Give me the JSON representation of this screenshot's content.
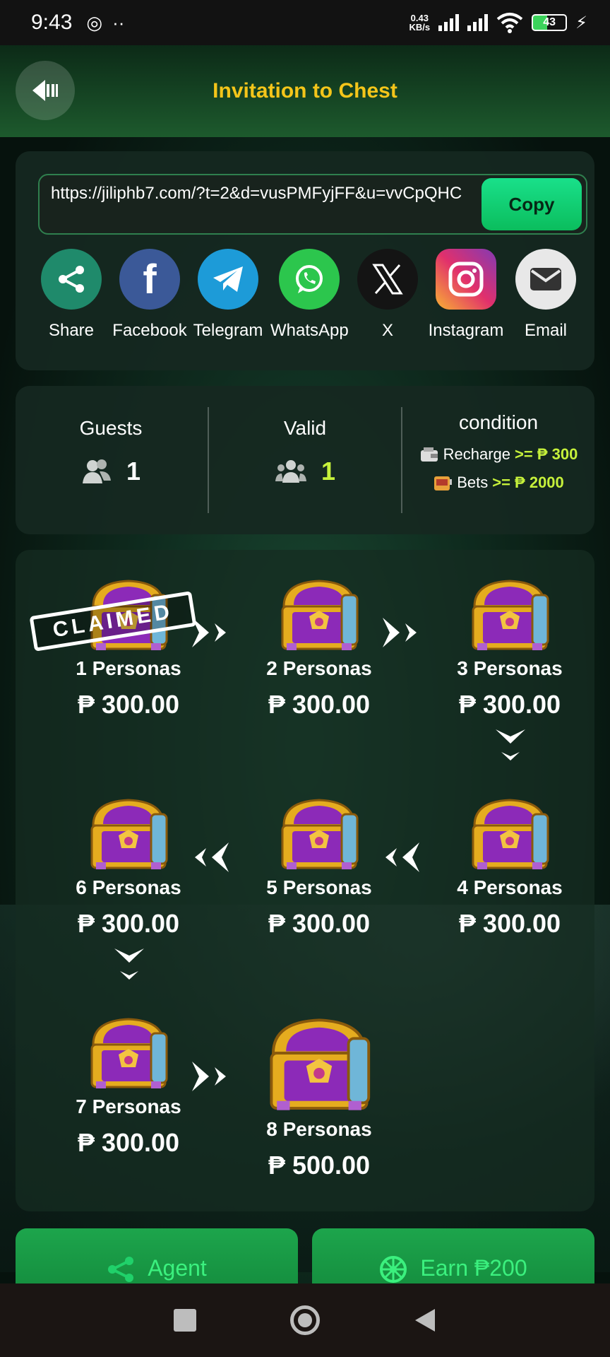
{
  "status_bar": {
    "time": "9:43",
    "net_speed_value": "0.43",
    "net_speed_unit": "KB/s",
    "battery": "43",
    "wifi_label": "6"
  },
  "header": {
    "title": "Invitation to Chest"
  },
  "invite": {
    "link": "https://jiliphb7.com/?t=2&d=vusPMFyjFF&u=vvCpQHC",
    "copy_label": "Copy"
  },
  "share": [
    {
      "label": "Share",
      "icon": "share-icon",
      "color": "#1f8a6b"
    },
    {
      "label": "Facebook",
      "icon": "facebook-icon",
      "color": "#3b5998"
    },
    {
      "label": "Telegram",
      "icon": "telegram-icon",
      "color": "#1d9bd8"
    },
    {
      "label": "WhatsApp",
      "icon": "whatsapp-icon",
      "color": "#2cc64d"
    },
    {
      "label": "X",
      "icon": "x-icon",
      "color": "#111111"
    },
    {
      "label": "Instagram",
      "icon": "instagram-icon",
      "color": "#d6307a"
    },
    {
      "label": "Email",
      "icon": "email-icon",
      "color": "#e8e8e8"
    }
  ],
  "stats": {
    "guests_label": "Guests",
    "guests_value": "1",
    "valid_label": "Valid",
    "valid_value": "1",
    "condition_label": "condition",
    "recharge_label": "Recharge",
    "recharge_req": ">= ₱ 300",
    "bets_label": "Bets",
    "bets_req": ">= ₱ 2000"
  },
  "chests": [
    {
      "label": "1 Personas",
      "amount": "₱ 300.00",
      "claimed": true
    },
    {
      "label": "2 Personas",
      "amount": "₱ 300.00",
      "claimed": false
    },
    {
      "label": "3 Personas",
      "amount": "₱ 300.00",
      "claimed": false
    },
    {
      "label": "4 Personas",
      "amount": "₱ 300.00",
      "claimed": false
    },
    {
      "label": "5 Personas",
      "amount": "₱ 300.00",
      "claimed": false
    },
    {
      "label": "6 Personas",
      "amount": "₱ 300.00",
      "claimed": false
    },
    {
      "label": "7 Personas",
      "amount": "₱ 300.00",
      "claimed": false
    },
    {
      "label": "8 Personas",
      "amount": "₱ 500.00",
      "claimed": false
    }
  ],
  "claimed_stamp": "CLAIMED",
  "bottom": {
    "agent_label": "Agent",
    "earn_label": "Earn ₱200"
  },
  "colors": {
    "accent_gold": "#f4c51a",
    "accent_green": "#c6f13b",
    "button_green": "#19e08a"
  }
}
